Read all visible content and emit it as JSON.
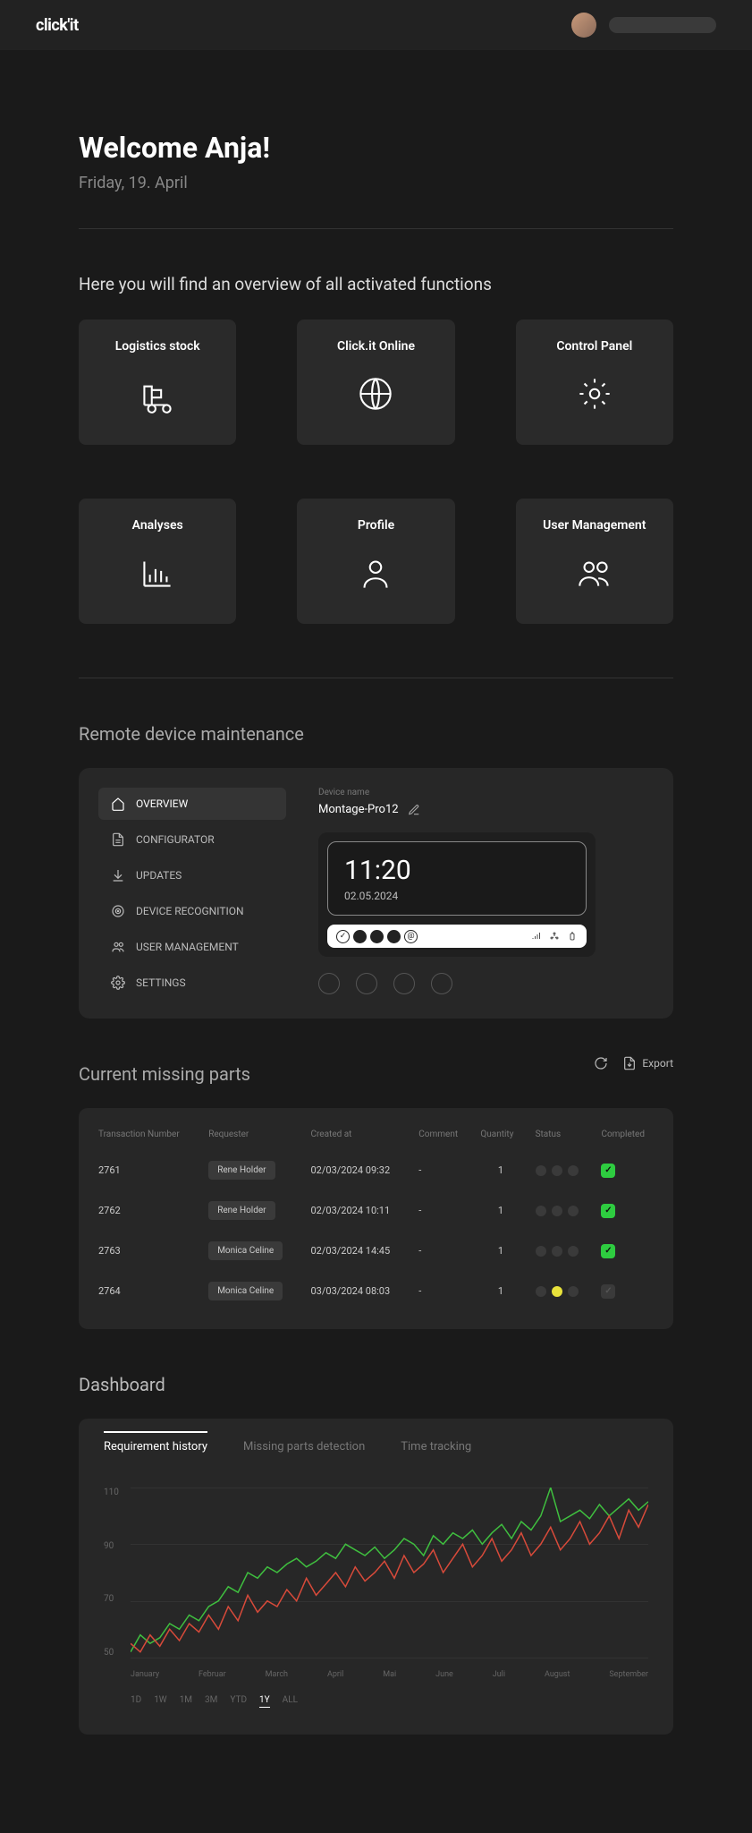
{
  "brand": "click'it",
  "header": {
    "welcome": "Welcome Anja!",
    "date": "Friday, 19. April",
    "subtitle": "Here you will find an overview of all activated functions"
  },
  "tiles": [
    {
      "id": "logistics",
      "label": "Logistics stock"
    },
    {
      "id": "online",
      "label": "Click.it Online"
    },
    {
      "id": "control",
      "label": "Control Panel"
    },
    {
      "id": "analyses",
      "label": "Analyses"
    },
    {
      "id": "profile",
      "label": "Profile"
    },
    {
      "id": "usermgmt",
      "label": "User Management"
    }
  ],
  "remote": {
    "title": "Remote device maintenance",
    "nav": [
      {
        "label": "OVERVIEW",
        "active": true
      },
      {
        "label": "CONFIGURATOR",
        "active": false
      },
      {
        "label": "UPDATES",
        "active": false
      },
      {
        "label": "DEVICE RECOGNITION",
        "active": false
      },
      {
        "label": "USER MANAGEMENT",
        "active": false
      },
      {
        "label": "SETTINGS",
        "active": false
      }
    ],
    "device_label": "Device name",
    "device_name": "Montage-Pro12",
    "clock_time": "11:20",
    "clock_date": "02.05.2024"
  },
  "parts": {
    "title": "Current missing parts",
    "export": "Export",
    "columns": [
      "Transaction Number",
      "Requester",
      "Created at",
      "Comment",
      "Quantity",
      "Status",
      "Completed"
    ],
    "rows": [
      {
        "txn": "2761",
        "requester": "Rene Holder",
        "created": "02/03/2024 09:32",
        "comment": "-",
        "qty": "1",
        "status": "gray",
        "completed": true
      },
      {
        "txn": "2762",
        "requester": "Rene Holder",
        "created": "02/03/2024 10:11",
        "comment": "-",
        "qty": "1",
        "status": "gray",
        "completed": true
      },
      {
        "txn": "2763",
        "requester": "Monica Celine",
        "created": "02/03/2024 14:45",
        "comment": "-",
        "qty": "1",
        "status": "gray",
        "completed": true
      },
      {
        "txn": "2764",
        "requester": "Monica Celine",
        "created": "03/03/2024 08:03",
        "comment": "-",
        "qty": "1",
        "status": "yellow",
        "completed": false
      }
    ]
  },
  "dashboard": {
    "title": "Dashboard",
    "tabs": [
      "Requirement history",
      "Missing parts detection",
      "Time tracking"
    ],
    "active_tab": 0,
    "months": [
      "January",
      "Februar",
      "March",
      "April",
      "Mai",
      "June",
      "Juli",
      "August",
      "September"
    ],
    "ranges": [
      "1D",
      "1W",
      "1M",
      "3M",
      "YTD",
      "1Y",
      "ALL"
    ],
    "active_range": "1Y"
  },
  "chart_data": {
    "type": "line",
    "title": "Requirement history",
    "xlabel": "",
    "ylabel": "",
    "ylim": [
      50,
      110
    ],
    "y_ticks": [
      50,
      70,
      90,
      110
    ],
    "categories": [
      "January",
      "Februar",
      "March",
      "April",
      "Mai",
      "June",
      "Juli",
      "August",
      "September"
    ],
    "series": [
      {
        "name": "green",
        "color": "#3fbf3f",
        "values": [
          52,
          58,
          55,
          57,
          62,
          60,
          65,
          63,
          68,
          70,
          75,
          73,
          80,
          78,
          82,
          80,
          83,
          85,
          82,
          84,
          87,
          85,
          90,
          88,
          86,
          89,
          85,
          88,
          92,
          90,
          86,
          93,
          90,
          94,
          92,
          95,
          90,
          94,
          97,
          92,
          98,
          95,
          100,
          110,
          98,
          100,
          102,
          99,
          104,
          100,
          103,
          106,
          102,
          105
        ]
      },
      {
        "name": "red",
        "color": "#d84a3a",
        "values": [
          55,
          52,
          58,
          54,
          60,
          56,
          62,
          59,
          65,
          60,
          68,
          63,
          72,
          66,
          70,
          68,
          74,
          70,
          78,
          72,
          76,
          80,
          75,
          82,
          77,
          80,
          84,
          78,
          86,
          80,
          83,
          88,
          80,
          85,
          90,
          82,
          86,
          92,
          84,
          88,
          94,
          86,
          90,
          96,
          88,
          92,
          98,
          90,
          94,
          100,
          92,
          102,
          96,
          104
        ]
      }
    ]
  }
}
